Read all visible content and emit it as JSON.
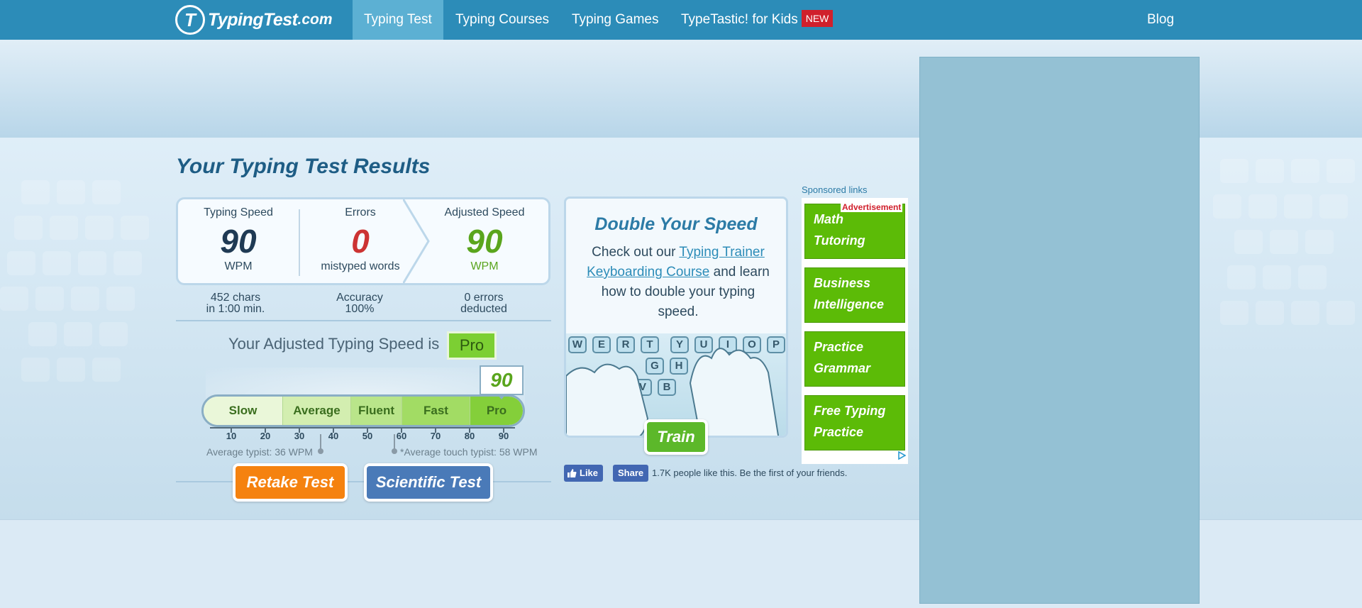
{
  "nav": {
    "logo_text": "TypingTest",
    "logo_suffix": ".com",
    "logo_letter": "T",
    "items": [
      {
        "label": "Typing Test"
      },
      {
        "label": "Typing Courses"
      },
      {
        "label": "Typing Games"
      },
      {
        "label": "TypeTastic! for Kids"
      }
    ],
    "new_badge": "NEW",
    "blog": "Blog"
  },
  "results": {
    "title": "Your Typing Test Results",
    "typing_speed": {
      "label": "Typing Speed",
      "value": "90",
      "unit": "WPM"
    },
    "errors": {
      "label": "Errors",
      "value": "0",
      "unit": "mistyped words"
    },
    "adjusted": {
      "label": "Adjusted Speed",
      "value": "90",
      "unit": "WPM"
    },
    "chars": {
      "line1": "452 chars",
      "line2": "in 1:00 min."
    },
    "accuracy": {
      "line1": "Accuracy",
      "line2": "100%"
    },
    "deducted": {
      "line1": "0 errors",
      "line2": "deducted"
    },
    "adjusted_line": "Your Adjusted Typing Speed is",
    "level": "Pro"
  },
  "meter": {
    "segments": [
      "Slow",
      "Average",
      "Fluent",
      "Fast",
      "Pro"
    ],
    "ticks": [
      "10",
      "20",
      "30",
      "40",
      "50",
      "60",
      "70",
      "80",
      "90"
    ],
    "current_value": "90",
    "average_typist": "Average typist: 36 WPM",
    "touch_typist": "*Average touch typist: 58 WPM"
  },
  "buttons": {
    "retake": "Retake Test",
    "scientific": "Scientific Test",
    "train": "Train"
  },
  "promo": {
    "title": "Double Your Speed",
    "text_before": "Check out our ",
    "link": "Typing Trainer Keyboarding Course",
    "text_after": " and learn how to double your typing speed.",
    "keys": [
      "W",
      "E",
      "R",
      "T",
      "Y",
      "U",
      "I",
      "O",
      "P",
      "G",
      "H",
      "V",
      "B"
    ]
  },
  "facebook": {
    "like": "Like",
    "share": "Share",
    "text": "1.7K people like this. Be the first of your friends."
  },
  "sponsored": {
    "label": "Sponsored links",
    "ad_tag": "Advertisement",
    "items": [
      "Math Tutoring",
      "Business Intelligence",
      "Practice Grammar",
      "Free Typing Practice"
    ]
  },
  "colors": {
    "nav": "#2c8cb8",
    "speed": "#1f3a54",
    "errors": "#cc3333",
    "adjusted": "#5aa51d",
    "retake": "#f5820f",
    "scientific": "#4a7ab8",
    "sponsored": "#5cbb07"
  }
}
